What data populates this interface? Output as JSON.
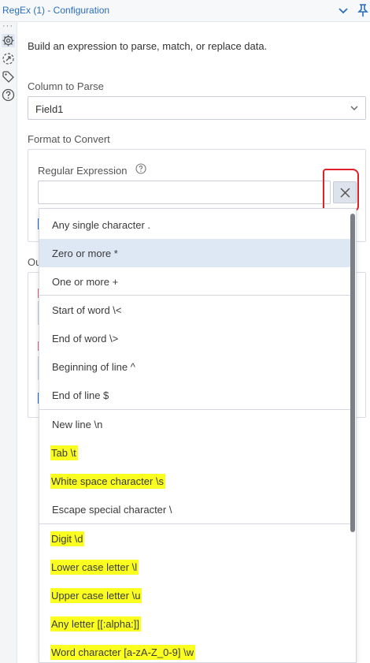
{
  "window": {
    "title": "RegEx (1) - Configuration"
  },
  "description": "Build an expression to parse, match, or replace data.",
  "column_to_parse": {
    "label": "Column to Parse",
    "value": "Field1"
  },
  "format_to_convert": {
    "label": "Format to Convert",
    "regex_label": "Regular Expression",
    "regex_value": ""
  },
  "background": {
    "output_label_partial": "Ou"
  },
  "colors": {
    "accent": "#2a6ebb",
    "selected_row": "#dee8f5",
    "highlight": "#fbff1f",
    "annotation_red": "#e0212a"
  },
  "menu": {
    "items": [
      {
        "label": "Any single character  .",
        "highlighted": false,
        "selected": false
      },
      {
        "label": "Zero or more  *",
        "highlighted": false,
        "selected": true
      },
      {
        "label": "One or more  +",
        "highlighted": false,
        "selected": false
      },
      {
        "label": "Start of word  \\<",
        "highlighted": false,
        "selected": false
      },
      {
        "label": "End of word  \\>",
        "highlighted": false,
        "selected": false
      },
      {
        "label": "Beginning of line  ^",
        "highlighted": false,
        "selected": false
      },
      {
        "label": "End of line  $",
        "highlighted": false,
        "selected": false
      },
      {
        "label": "New line  \\n",
        "highlighted": false,
        "selected": false
      },
      {
        "label": "Tab  \\t",
        "highlighted": true,
        "selected": false
      },
      {
        "label": "White space character  \\s",
        "highlighted": true,
        "selected": false
      },
      {
        "label": "Escape special character  \\",
        "highlighted": false,
        "selected": false
      },
      {
        "label": "Digit  \\d",
        "highlighted": true,
        "selected": false
      },
      {
        "label": "Lower case letter  \\l",
        "highlighted": true,
        "selected": false
      },
      {
        "label": "Upper case letter  \\u",
        "highlighted": true,
        "selected": false
      },
      {
        "label": "Any letter  [[:alpha:]]",
        "highlighted": true,
        "selected": false
      },
      {
        "label": "Word character [a-zA-Z_0-9]  \\w",
        "highlighted": true,
        "selected": false
      }
    ]
  }
}
